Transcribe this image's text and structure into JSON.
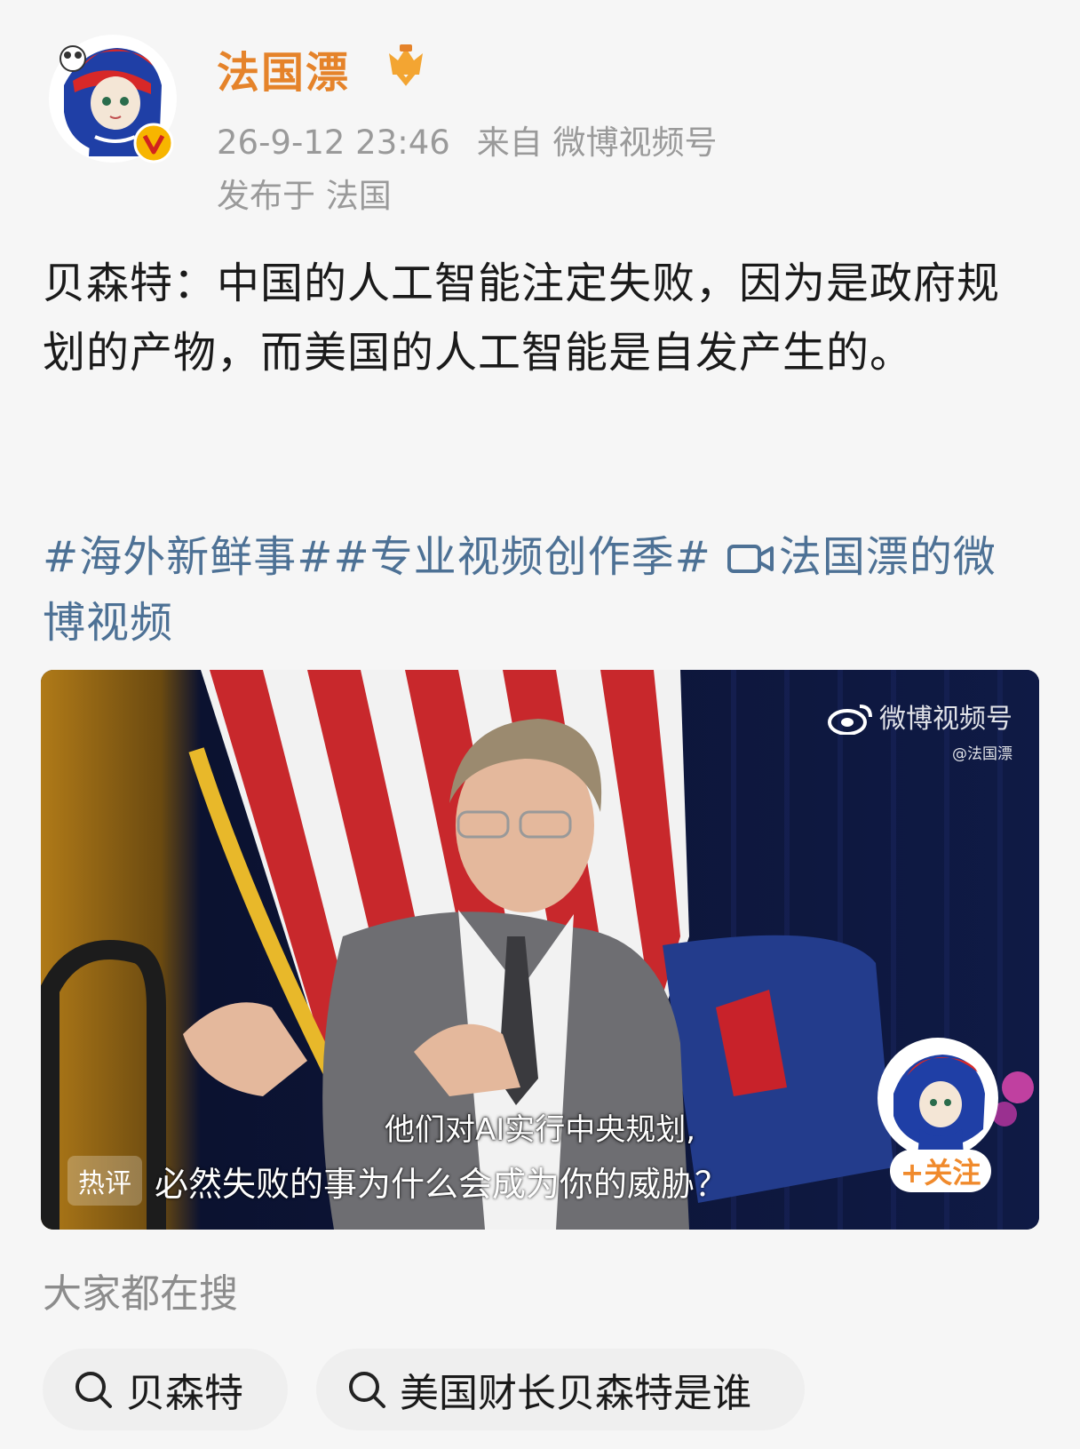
{
  "post": {
    "username": "法国漂",
    "timestamp": "26-9-12 23:46",
    "source": "来自 微博视频号",
    "location": "发布于 法国",
    "text": "贝森特：中国的人工智能注定失败，因为是政府规划的产物，而美国的人工智能是自发产生的。",
    "tag1": "#海外新鲜事#",
    "tag2": "#专业视频创作季#",
    "video_link": "法国漂的微博视频"
  },
  "video": {
    "watermark_title": "微博视频号",
    "watermark_handle": "@法国漂",
    "subtitle": "他们对AI实行中央规划,",
    "hot_badge": "热评",
    "hot_comment": "必然失败的事为什么会成为你的威胁？",
    "follow_label": "+关注"
  },
  "search": {
    "title": "大家都在搜",
    "chips": [
      "贝森特",
      "美国财长贝森特是谁"
    ]
  },
  "icons": {
    "verified": "verified-v-icon",
    "vip": "vip-crown-icon",
    "video": "video-camera-icon",
    "weibo": "weibo-logo-icon",
    "search": "search-icon"
  },
  "colors": {
    "username": "#e5832a",
    "tag": "#4d7195",
    "meta": "#9a9a9a"
  }
}
